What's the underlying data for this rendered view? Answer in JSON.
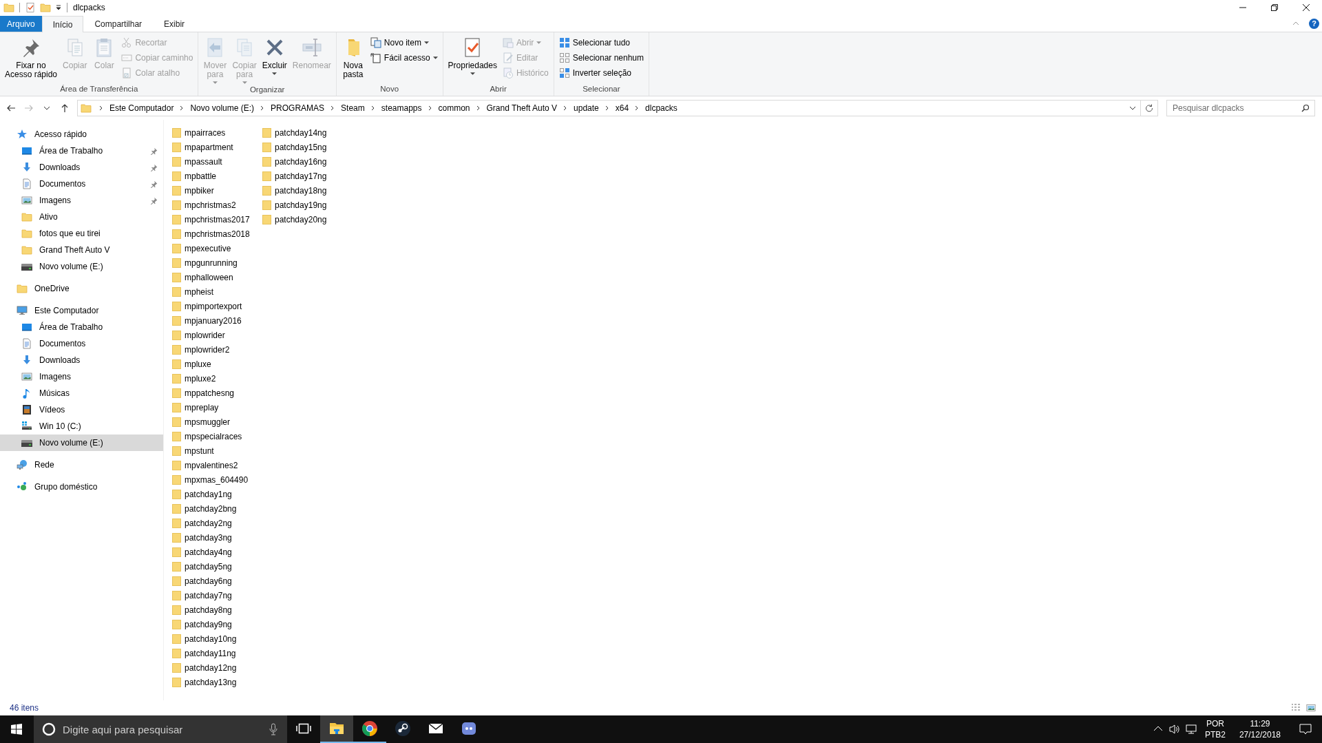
{
  "title_bar": {
    "title": "dlcpacks"
  },
  "tabs": [
    {
      "label": "Arquivo",
      "kind": "file",
      "selected": false
    },
    {
      "label": "Início",
      "kind": "tab",
      "selected": true
    },
    {
      "label": "Compartilhar",
      "kind": "tab",
      "selected": false
    },
    {
      "label": "Exibir",
      "kind": "tab",
      "selected": false
    }
  ],
  "help_button": "?",
  "ribbon": {
    "groups": [
      {
        "label": "Área de Transferência",
        "columns": [
          {
            "kind": "large",
            "buttons": [
              {
                "label": "Fixar no\nAcesso rápido",
                "kind": "pin",
                "disabled": false,
                "dropdown": false
              }
            ]
          },
          {
            "kind": "large",
            "buttons": [
              {
                "label": "Copiar",
                "kind": "copy",
                "disabled": true,
                "dropdown": false
              }
            ]
          },
          {
            "kind": "large",
            "buttons": [
              {
                "label": "Colar",
                "kind": "paste",
                "disabled": true,
                "dropdown": false
              }
            ]
          },
          {
            "kind": "stack",
            "buttons": [
              {
                "label": "Recortar",
                "kind": "scissors",
                "disabled": true,
                "dropdown": false
              },
              {
                "label": "Copiar caminho",
                "kind": "path",
                "disabled": true,
                "dropdown": false
              },
              {
                "label": "Colar atalho",
                "kind": "shortcut",
                "disabled": true,
                "dropdown": false
              }
            ]
          }
        ]
      },
      {
        "label": "Organizar",
        "columns": [
          {
            "kind": "large",
            "buttons": [
              {
                "label": "Mover\npara",
                "kind": "move",
                "disabled": true,
                "dropdown": true
              }
            ]
          },
          {
            "kind": "large",
            "buttons": [
              {
                "label": "Copiar\npara",
                "kind": "copyto",
                "disabled": true,
                "dropdown": true
              }
            ]
          },
          {
            "kind": "large",
            "buttons": [
              {
                "label": "Excluir",
                "kind": "delete",
                "disabled": false,
                "dropdown": true
              }
            ]
          },
          {
            "kind": "large",
            "buttons": [
              {
                "label": "Renomear",
                "kind": "rename",
                "disabled": true,
                "dropdown": false
              }
            ]
          }
        ]
      },
      {
        "label": "Novo",
        "columns": [
          {
            "kind": "large",
            "buttons": [
              {
                "label": "Nova\npasta",
                "kind": "folder",
                "disabled": false,
                "dropdown": false
              }
            ]
          },
          {
            "kind": "stack",
            "buttons": [
              {
                "label": "Novo item",
                "kind": "newitem",
                "disabled": false,
                "dropdown": true
              },
              {
                "label": "Fácil acesso",
                "kind": "easy",
                "disabled": false,
                "dropdown": true
              }
            ]
          }
        ]
      },
      {
        "label": "Abrir",
        "columns": [
          {
            "kind": "large",
            "buttons": [
              {
                "label": "Propriedades",
                "kind": "properties",
                "disabled": false,
                "dropdown": true
              }
            ]
          },
          {
            "kind": "stack",
            "buttons": [
              {
                "label": "Abrir",
                "kind": "open",
                "disabled": true,
                "dropdown": true
              },
              {
                "label": "Editar",
                "kind": "edit",
                "disabled": true,
                "dropdown": false
              },
              {
                "label": "Histórico",
                "kind": "history",
                "disabled": true,
                "dropdown": false
              }
            ]
          }
        ]
      },
      {
        "label": "Selecionar",
        "columns": [
          {
            "kind": "stack",
            "buttons": [
              {
                "label": "Selecionar tudo",
                "kind": "selall",
                "disabled": false,
                "dropdown": false
              },
              {
                "label": "Selecionar nenhum",
                "kind": "selnone",
                "disabled": false,
                "dropdown": false
              },
              {
                "label": "Inverter seleção",
                "kind": "invert",
                "disabled": false,
                "dropdown": false
              }
            ]
          }
        ]
      }
    ]
  },
  "address_bar": {
    "path": [
      "Este Computador",
      "Novo volume (E:)",
      "PROGRAMAS",
      "Steam",
      "steamapps",
      "common",
      "Grand Theft Auto V",
      "update",
      "x64",
      "dlcpacks"
    ],
    "search_placeholder": "Pesquisar dlcpacks"
  },
  "navigation_pane": {
    "items": [
      {
        "label": "Acesso rápido",
        "kind": "star",
        "selected": false,
        "pinned": false,
        "children": [
          {
            "label": "Área de Trabalho",
            "kind": "desktop",
            "selected": false,
            "pinned": true
          },
          {
            "label": "Downloads",
            "kind": "download",
            "selected": false,
            "pinned": true
          },
          {
            "label": "Documentos",
            "kind": "document",
            "selected": false,
            "pinned": true
          },
          {
            "label": "Imagens",
            "kind": "images",
            "selected": false,
            "pinned": true
          },
          {
            "label": "Ativo",
            "kind": "folder",
            "selected": false,
            "pinned": false
          },
          {
            "label": "fotos que eu tirei",
            "kind": "folder",
            "selected": false,
            "pinned": false
          },
          {
            "label": "Grand Theft Auto V",
            "kind": "folder",
            "selected": false,
            "pinned": false
          },
          {
            "label": "Novo volume (E:)",
            "kind": "drive",
            "selected": false,
            "pinned": false
          }
        ]
      },
      {
        "label": "OneDrive",
        "kind": "folder",
        "selected": false,
        "pinned": false
      },
      {
        "label": "Este Computador",
        "kind": "computer",
        "selected": false,
        "pinned": false,
        "children": [
          {
            "label": "Área de Trabalho",
            "kind": "desktop",
            "selected": false,
            "pinned": false
          },
          {
            "label": "Documentos",
            "kind": "document",
            "selected": false,
            "pinned": false
          },
          {
            "label": "Downloads",
            "kind": "download",
            "selected": false,
            "pinned": false
          },
          {
            "label": "Imagens",
            "kind": "images",
            "selected": false,
            "pinned": false
          },
          {
            "label": "Músicas",
            "kind": "music",
            "selected": false,
            "pinned": false
          },
          {
            "label": "Vídeos",
            "kind": "video",
            "selected": false,
            "pinned": false
          },
          {
            "label": "Win 10 (C:)",
            "kind": "windrive",
            "selected": false,
            "pinned": false
          },
          {
            "label": "Novo volume (E:)",
            "kind": "drive",
            "selected": true,
            "pinned": false
          }
        ]
      },
      {
        "label": "Rede",
        "kind": "network",
        "selected": false,
        "pinned": false
      },
      {
        "label": "Grupo doméstico",
        "kind": "homegroup",
        "selected": false,
        "pinned": false
      }
    ]
  },
  "files": [
    "mpairraces",
    "mpapartment",
    "mpassault",
    "mpbattle",
    "mpbiker",
    "mpchristmas2",
    "mpchristmas2017",
    "mpchristmas2018",
    "mpexecutive",
    "mpgunrunning",
    "mphalloween",
    "mpheist",
    "mpimportexport",
    "mpjanuary2016",
    "mplowrider",
    "mplowrider2",
    "mpluxe",
    "mpluxe2",
    "mppatchesng",
    "mpreplay",
    "mpsmuggler",
    "mpspecialraces",
    "mpstunt",
    "mpvalentines2",
    "mpxmas_604490",
    "patchday1ng",
    "patchday2bng",
    "patchday2ng",
    "patchday3ng",
    "patchday4ng",
    "patchday5ng",
    "patchday6ng",
    "patchday7ng",
    "patchday8ng",
    "patchday9ng",
    "patchday10ng",
    "patchday11ng",
    "patchday12ng",
    "patchday13ng",
    "patchday14ng",
    "patchday15ng",
    "patchday16ng",
    "patchday17ng",
    "patchday18ng",
    "patchday19ng",
    "patchday20ng"
  ],
  "status_bar": {
    "item_count": "46 itens"
  },
  "taskbar": {
    "search_placeholder": "Digite aqui para pesquisar",
    "apps": [
      {
        "kind": "explorer",
        "running": true,
        "active": true
      },
      {
        "kind": "chrome",
        "running": true,
        "active": false
      },
      {
        "kind": "steam",
        "running": false,
        "active": false
      },
      {
        "kind": "mail",
        "running": false,
        "active": false
      },
      {
        "kind": "discord",
        "running": false,
        "active": false
      }
    ],
    "language": "POR",
    "layout": "PTB2",
    "time": "11:29",
    "date": "27/12/2018"
  }
}
